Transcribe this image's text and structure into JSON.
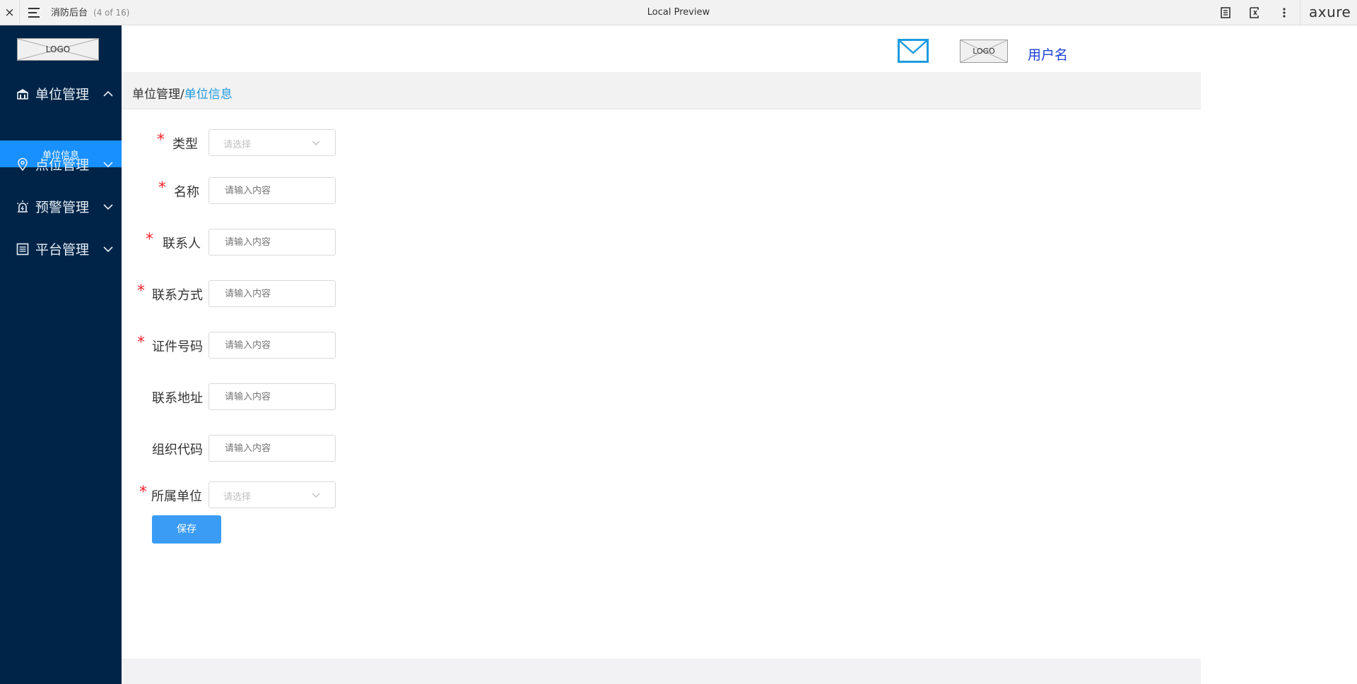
{
  "preview_bar": {
    "close_glyph": "×",
    "project_name": "消防后台",
    "page_count": "(4 of 16)",
    "title": "Local Preview",
    "brand": "axure",
    "icons": [
      "menu-icon",
      "notes-icon",
      "page-reference-icon",
      "more-vertical-icon"
    ]
  },
  "sidebar": {
    "logo_text": "LOGO",
    "items": [
      {
        "label": "单位管理",
        "icon": "building-icon",
        "expanded": true
      },
      {
        "label": "点位管理",
        "icon": "location-pin-icon",
        "expanded": false
      },
      {
        "label": "预警管理",
        "icon": "alarm-light-icon",
        "expanded": false
      },
      {
        "label": "平台管理",
        "icon": "document-list-icon",
        "expanded": false
      }
    ],
    "active_sub_item": "单位信息",
    "colors": {
      "background": "#002448",
      "active": "#1890ff"
    }
  },
  "header": {
    "mail_icon": "mail-icon",
    "logo_text": "LOGO",
    "username": "用户名"
  },
  "breadcrumb": {
    "parent": "单位管理",
    "separator": "/",
    "current": "单位信息"
  },
  "form": {
    "required_mark": "*",
    "fields": [
      {
        "label": "类型",
        "required": true,
        "type": "select",
        "placeholder": "请选择"
      },
      {
        "label": "名称",
        "required": true,
        "type": "input",
        "placeholder": "请输入内容"
      },
      {
        "label": "联系人",
        "required": true,
        "type": "input",
        "placeholder": "请输入内容"
      },
      {
        "label": "联系方式",
        "required": true,
        "type": "input",
        "placeholder": "请输入内容"
      },
      {
        "label": "证件号码",
        "required": true,
        "type": "input",
        "placeholder": "请输入内容"
      },
      {
        "label": "联系地址",
        "required": false,
        "type": "input",
        "placeholder": "请输入内容"
      },
      {
        "label": "组织代码",
        "required": false,
        "type": "input",
        "placeholder": "请输入内容"
      },
      {
        "label": "所属单位",
        "required": true,
        "type": "select",
        "placeholder": "请选择"
      }
    ],
    "save_label": "保存"
  }
}
